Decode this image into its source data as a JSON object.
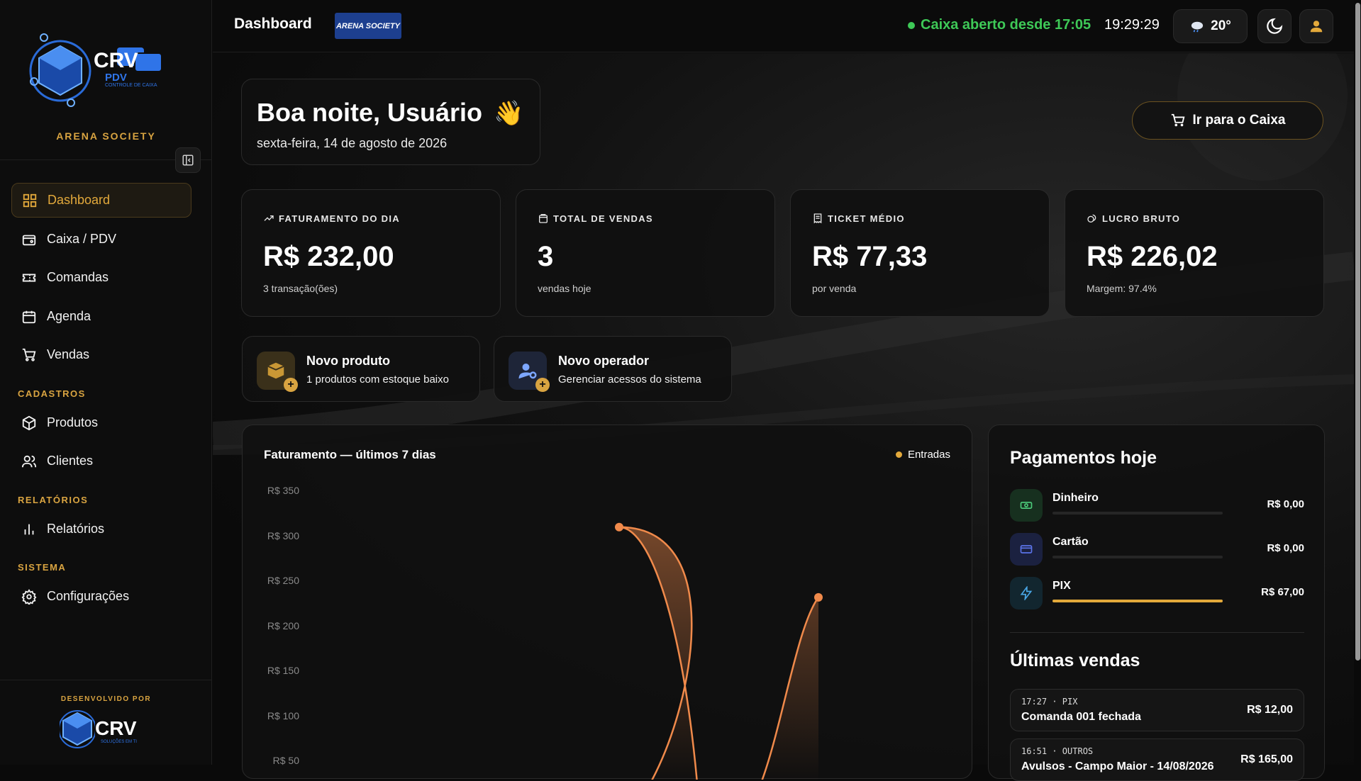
{
  "sidebar": {
    "brand": "ARENA SOCIETY",
    "logo_text": "CRV",
    "logo_sub": "PDV",
    "logo_tagline": "CONTROLE DE CAIXA",
    "nav": [
      {
        "label": "Dashboard",
        "icon": "grid-icon",
        "active": true
      },
      {
        "label": "Caixa / PDV",
        "icon": "register-icon"
      },
      {
        "label": "Comandas",
        "icon": "ticket-icon"
      },
      {
        "label": "Agenda",
        "icon": "calendar-icon"
      },
      {
        "label": "Vendas",
        "icon": "cart-icon"
      }
    ],
    "sections": {
      "cadastros": "CADASTROS",
      "relatorios": "RELATÓRIOS",
      "sistema": "SISTEMA"
    },
    "cadastros_items": [
      {
        "label": "Produtos",
        "icon": "box-icon"
      },
      {
        "label": "Clientes",
        "icon": "users-icon"
      }
    ],
    "relatorios_items": [
      {
        "label": "Relatórios",
        "icon": "bar-chart-icon"
      }
    ],
    "sistema_items": [
      {
        "label": "Configurações",
        "icon": "gear-icon"
      }
    ],
    "developed_by": "DESENVOLVIDO POR",
    "dev_logo_text": "CRV",
    "dev_logo_sub": "SOLUÇÕES EM TI"
  },
  "topbar": {
    "title": "Dashboard",
    "arena_badge": "ARENA SOCIETY",
    "status": "Caixa aberto desde 17:05",
    "clock": "19:29:29",
    "weather": "20°"
  },
  "greeting": {
    "title": "Boa noite, Usuário",
    "emoji": "👋",
    "date": "sexta-feira, 14 de agosto de 2026"
  },
  "caixa_button": "Ir para o Caixa",
  "stats": [
    {
      "label": "FATURAMENTO DO DIA",
      "value": "R$ 232,00",
      "sub": "3 transação(ões)"
    },
    {
      "label": "TOTAL DE VENDAS",
      "value": "3",
      "sub": "vendas hoje"
    },
    {
      "label": "TICKET MÉDIO",
      "value": "R$ 77,33",
      "sub": "por venda"
    },
    {
      "label": "LUCRO BRUTO",
      "value": "R$ 226,02",
      "sub": "Margem: 97.4%"
    }
  ],
  "quick_actions": [
    {
      "title": "Novo produto",
      "sub": "1 produtos com estoque baixo"
    },
    {
      "title": "Novo operador",
      "sub": "Gerenciar acessos do sistema"
    }
  ],
  "chart_data": {
    "type": "area",
    "title": "Faturamento — últimos 7 dias",
    "legend": "Entradas",
    "legend_position": "top-right",
    "y_ticks": [
      "R$ 350",
      "R$ 300",
      "R$ 250",
      "R$ 200",
      "R$ 150",
      "R$ 100",
      "R$ 50"
    ],
    "ylim": [
      0,
      350
    ],
    "visible_points": [
      {
        "index": 4,
        "value": 310
      },
      {
        "index": 6,
        "value": 232
      }
    ],
    "series_color": "#f08a4b"
  },
  "payments": {
    "title": "Pagamentos hoje",
    "items": [
      {
        "name": "Dinheiro",
        "amount": "R$ 0,00",
        "share": 0,
        "icon": "cash-icon",
        "color": "#1f3a2a"
      },
      {
        "name": "Cartão",
        "amount": "R$ 0,00",
        "share": 0,
        "icon": "card-icon",
        "color": "#1d2340"
      },
      {
        "name": "PIX",
        "amount": "R$ 67,00",
        "share": 1,
        "icon": "bolt-icon",
        "color": "#142a36"
      }
    ]
  },
  "recent_sales": {
    "title": "Últimas vendas",
    "items": [
      {
        "meta": "17:27 · PIX",
        "desc": "Comanda 001 fechada",
        "amount": "R$ 12,00"
      },
      {
        "meta": "16:51 · OUTROS",
        "desc": "Avulsos - Campo Maior - 14/08/2026",
        "amount": "R$ 165,00"
      }
    ]
  }
}
